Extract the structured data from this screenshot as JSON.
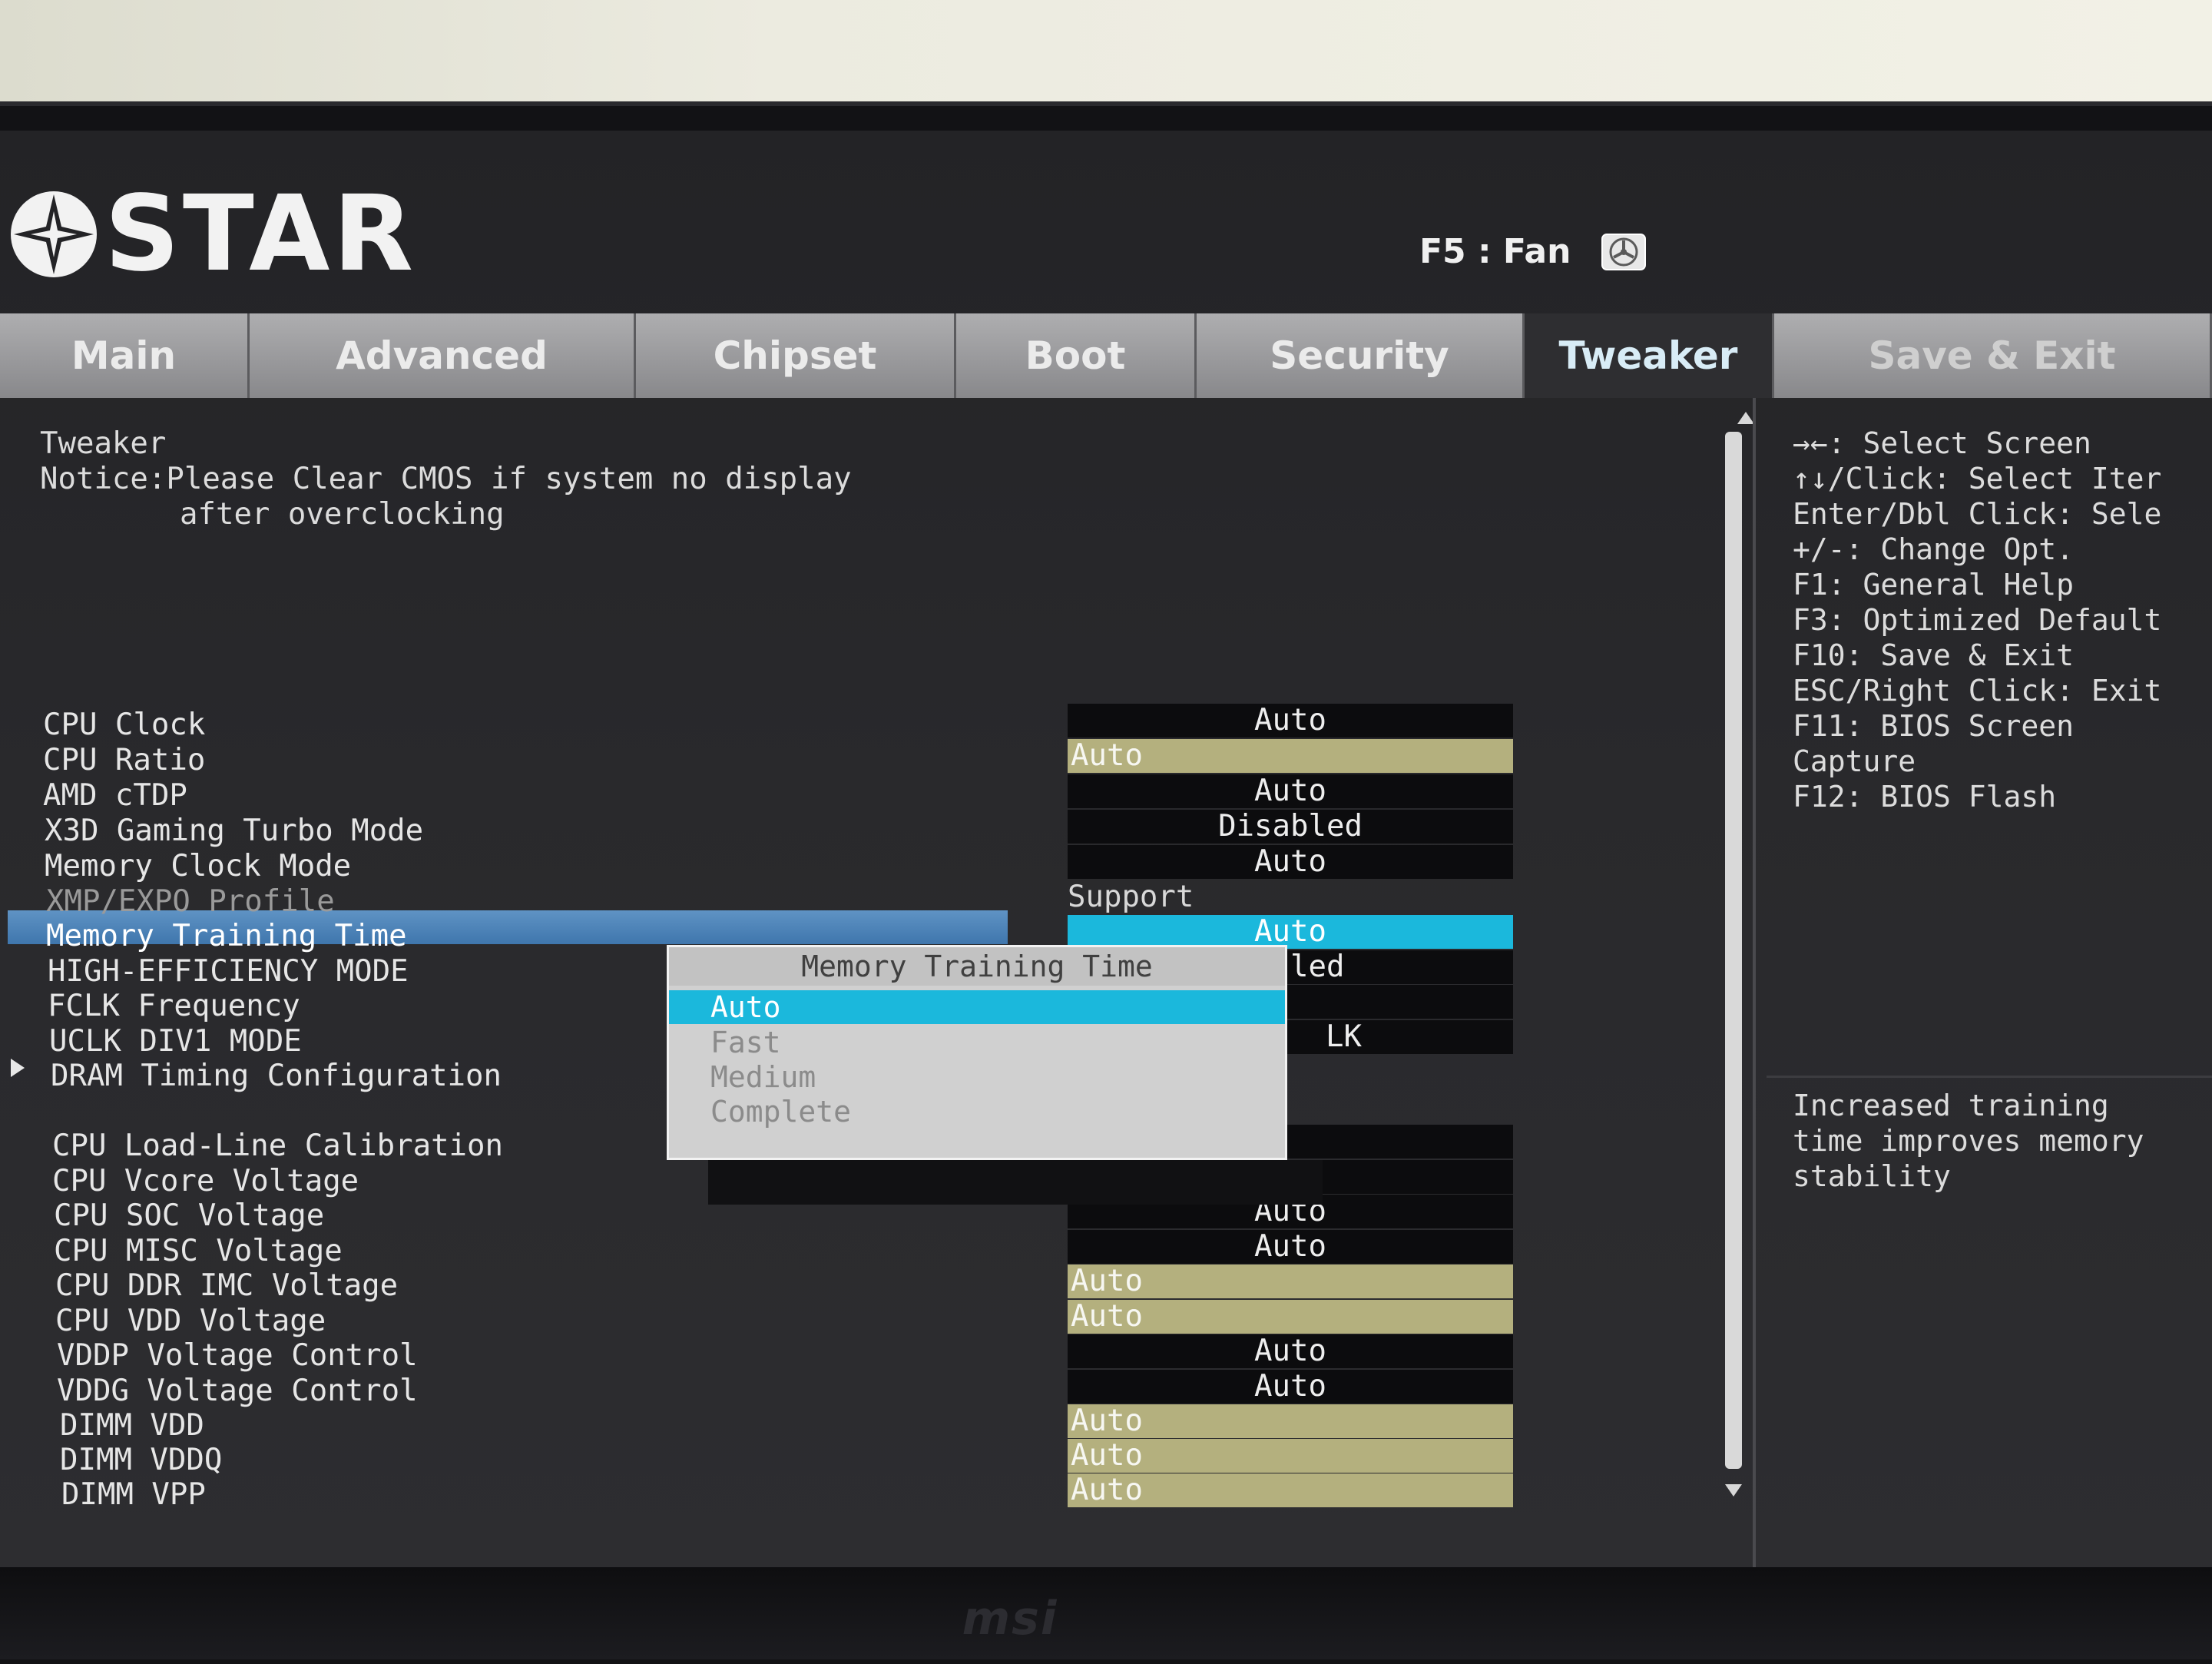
{
  "header": {
    "brand": "STAR",
    "fan_hint": "F5 : Fan",
    "monitor_logo": "msi"
  },
  "tabs": [
    {
      "label": "Main"
    },
    {
      "label": "Advanced"
    },
    {
      "label": "Chipset"
    },
    {
      "label": "Boot"
    },
    {
      "label": "Security"
    },
    {
      "label": "Tweaker",
      "active": true
    },
    {
      "label": "Save & Exit"
    }
  ],
  "content": {
    "section_title": "Tweaker",
    "notice_line1": "Notice:Please Clear CMOS if system no display",
    "notice_line2": "after overclocking",
    "settings": [
      {
        "label": "CPU Clock",
        "value": "Auto",
        "style": "dark"
      },
      {
        "label": "CPU Ratio",
        "value": "Auto",
        "style": "khaki"
      },
      {
        "label": "AMD cTDP",
        "value": "Auto",
        "style": "dark"
      },
      {
        "label": "X3D Gaming Turbo Mode",
        "value": "Disabled",
        "style": "dark"
      },
      {
        "label": "Memory Clock Mode",
        "value": "Auto",
        "style": "dark"
      },
      {
        "label": "XMP/EXPO Profile",
        "value": "Support",
        "style": "plain",
        "greyed": true
      },
      {
        "label": "Memory Training Time",
        "value": "Auto",
        "style": "cyan",
        "selected": true
      },
      {
        "label": "HIGH-EFFICIENCY MODE",
        "value": "led",
        "style": "dark"
      },
      {
        "label": "FCLK Frequency",
        "value": "",
        "style": "dark"
      },
      {
        "label": "UCLK DIV1 MODE",
        "value": "LK",
        "style": "dark"
      },
      {
        "label": "DRAM Timing Configuration",
        "value": "",
        "style": "none",
        "submenu": true
      },
      {
        "label": "CPU Load-Line Calibration",
        "value": "",
        "style": "dark"
      },
      {
        "label": "CPU Vcore Voltage",
        "value": "",
        "style": "dark"
      },
      {
        "label": "CPU SOC Voltage",
        "value": "Auto",
        "style": "dark"
      },
      {
        "label": "CPU MISC Voltage",
        "value": "Auto",
        "style": "dark"
      },
      {
        "label": "CPU DDR IMC Voltage",
        "value": "Auto",
        "style": "khaki"
      },
      {
        "label": "CPU VDD Voltage",
        "value": "Auto",
        "style": "khaki"
      },
      {
        "label": "VDDP Voltage Control",
        "value": "Auto",
        "style": "dark"
      },
      {
        "label": "VDDG Voltage Control",
        "value": "Auto",
        "style": "dark"
      },
      {
        "label": "DIMM VDD",
        "value": "Auto",
        "style": "khaki"
      },
      {
        "label": "DIMM VDDQ",
        "value": "Auto",
        "style": "khaki"
      },
      {
        "label": "DIMM VPP",
        "value": "Auto",
        "style": "khaki"
      }
    ]
  },
  "popup": {
    "title": "Memory Training Time",
    "options": [
      "Auto",
      "Fast",
      "Medium",
      "Complete"
    ],
    "selected_index": 0
  },
  "help": {
    "keys": [
      "→←: Select Screen",
      "↑↓/Click: Select Iter",
      "Enter/Dbl Click: Sele",
      "+/-: Change Opt.",
      "F1: General Help",
      "F3: Optimized Default",
      "F10: Save & Exit",
      "ESC/Right Click: Exit",
      "F11: BIOS Screen",
      "Capture",
      "F12: BIOS Flash"
    ],
    "description": [
      "Increased training",
      "time improves memory",
      "stability"
    ]
  },
  "colors": {
    "selection_cyan": "#1bb8dc",
    "khaki": "#b4b07e",
    "highlight_blue": "#4a80b6"
  }
}
